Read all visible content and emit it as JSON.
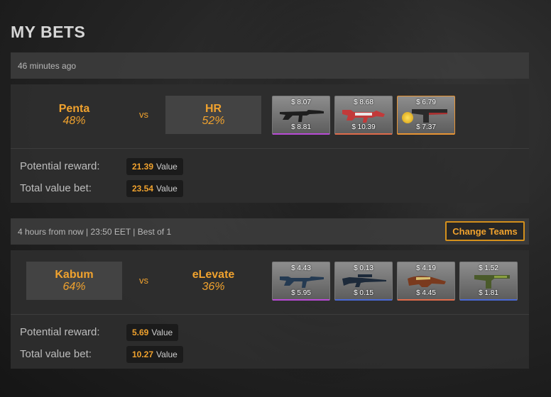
{
  "page_title": "MY BETS",
  "bets": [
    {
      "time_text": "46 minutes ago",
      "team1": {
        "name": "Penta",
        "pct": "48%"
      },
      "vs": "vs",
      "team2": {
        "name": "HR",
        "pct": "52%"
      },
      "items": [
        {
          "top": "$ 8.07",
          "bottom": "$ 8.81",
          "icon": "ak47-icon",
          "rarity_color": "#b84bd6"
        },
        {
          "top": "$ 8.68",
          "bottom": "$ 10.39",
          "icon": "m4a4-icon",
          "rarity_color": "#e06b4a"
        },
        {
          "top": "$ 6.79",
          "bottom": "$ 7.37",
          "icon": "usp-s-icon",
          "rarity_color": "#e89434"
        }
      ],
      "potential_label": "Potential reward:",
      "potential_value": "21.39",
      "total_label": "Total value bet:",
      "total_value": "23.54",
      "value_unit": "Value"
    },
    {
      "time_text": "4 hours from now | 23:50 EET | Best of 1",
      "change_button": "Change Teams",
      "team1": {
        "name": "Kabum",
        "pct": "64%"
      },
      "vs": "vs",
      "team2": {
        "name": "eLevate",
        "pct": "36%"
      },
      "items": [
        {
          "top": "$ 4.43",
          "bottom": "$ 5.95",
          "icon": "m4a1-s-icon",
          "rarity_color": "#b84bd6"
        },
        {
          "top": "$ 0.13",
          "bottom": "$ 0.15",
          "icon": "sniper-rifle-icon",
          "rarity_color": "#4b69d6"
        },
        {
          "top": "$ 4.19",
          "bottom": "$ 4.45",
          "icon": "p90-icon",
          "rarity_color": "#e06b4a"
        },
        {
          "top": "$ 1.52",
          "bottom": "$ 1.81",
          "icon": "usp-s-icon",
          "rarity_color": "#4b69d6"
        }
      ],
      "potential_label": "Potential reward:",
      "potential_value": "5.69",
      "total_label": "Total value bet:",
      "total_value": "10.27",
      "value_unit": "Value"
    }
  ]
}
